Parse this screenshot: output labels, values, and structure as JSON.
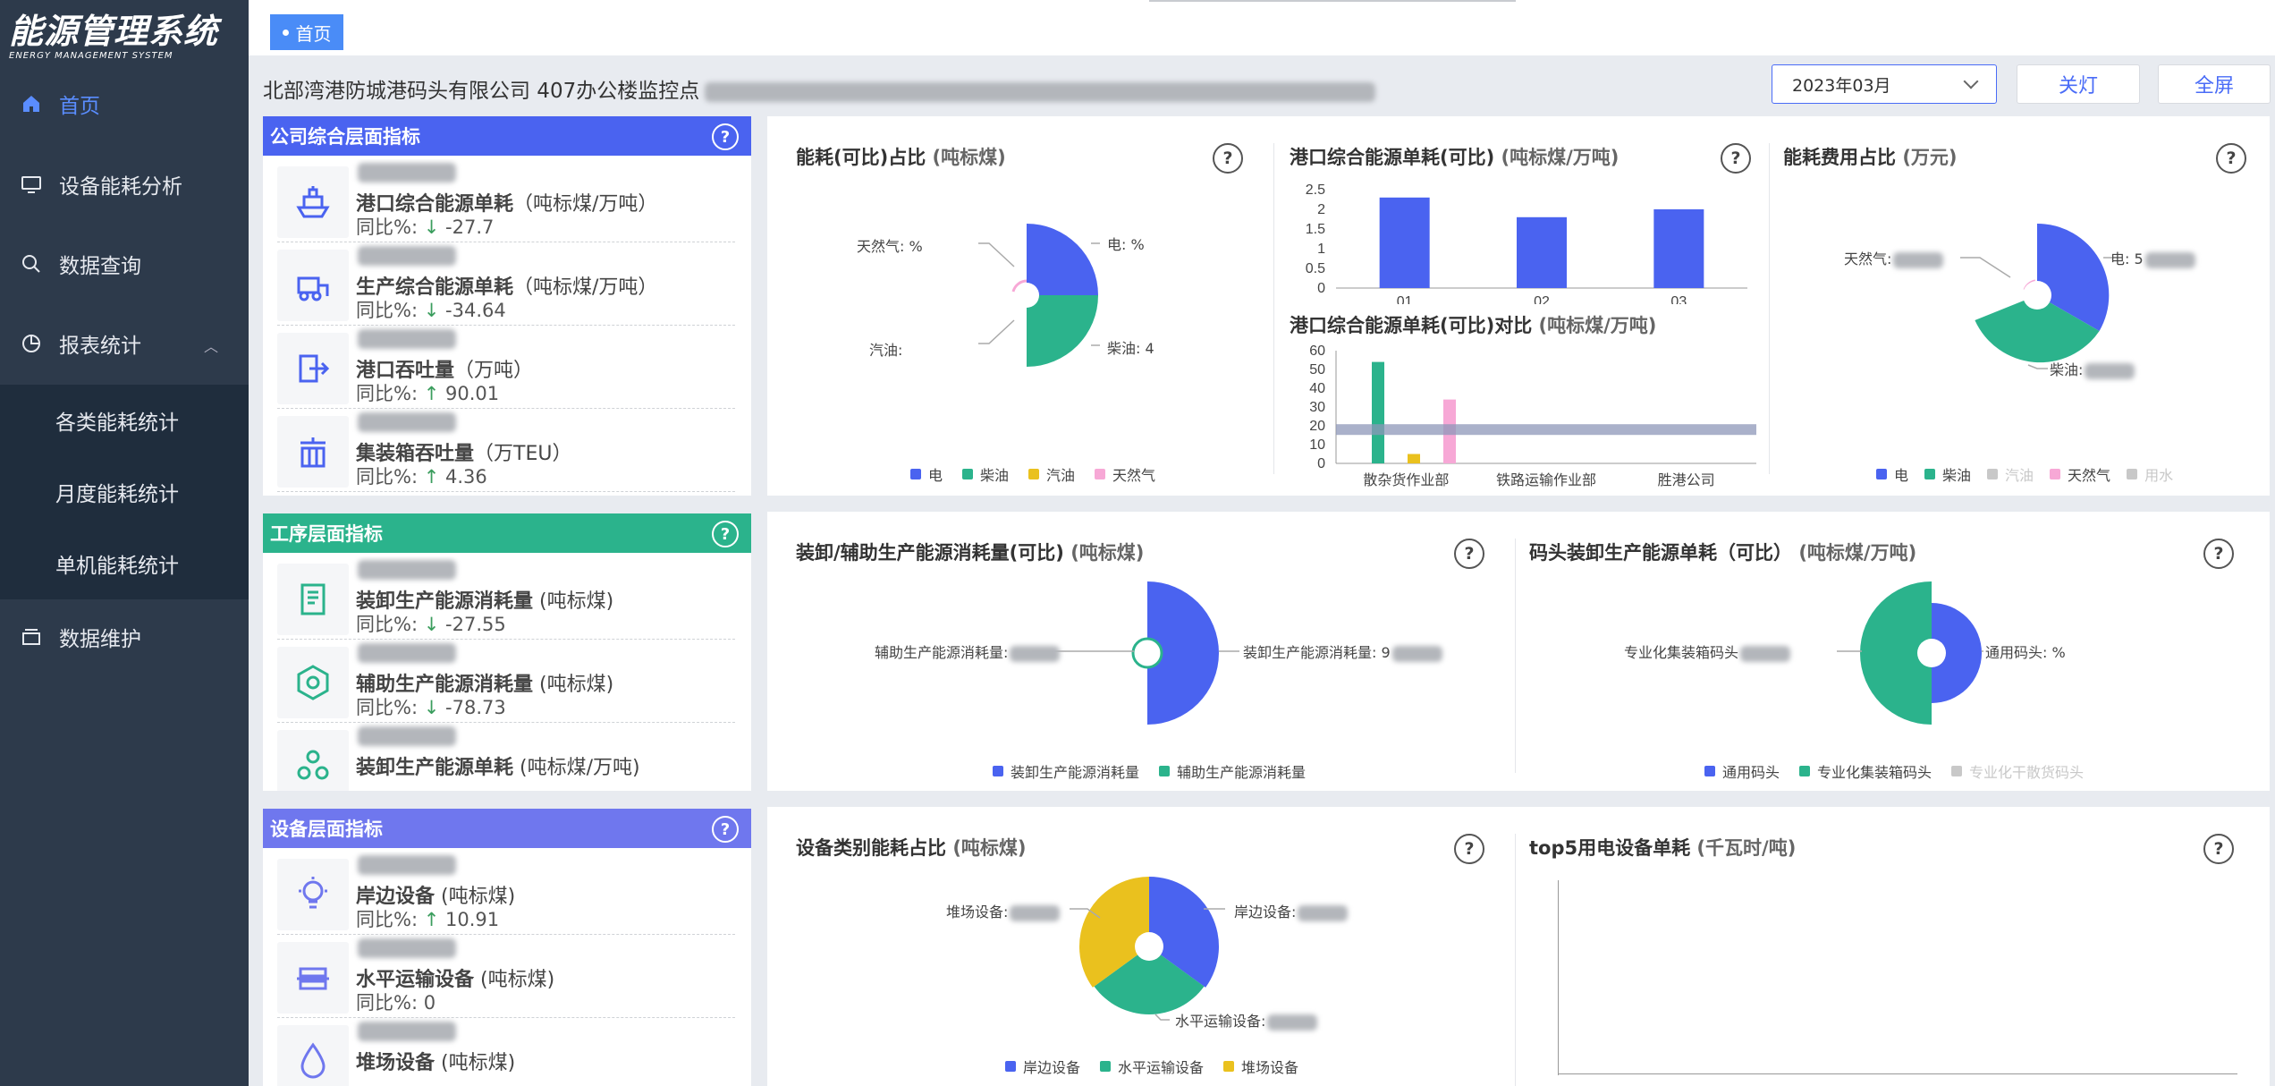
{
  "sidebar": {
    "logo_title": "能源管理系统",
    "logo_subtitle": "ENERGY MANAGEMENT SYSTEM",
    "items": [
      {
        "label": "首页",
        "icon": "home-icon"
      },
      {
        "label": "设备能耗分析",
        "icon": "monitor-icon"
      },
      {
        "label": "数据查询",
        "icon": "search-icon"
      },
      {
        "label": "报表统计",
        "icon": "pie-icon"
      },
      {
        "label": "数据维护",
        "icon": "stack-icon"
      }
    ],
    "subitems": [
      "各类能耗统计",
      "月度能耗统计",
      "单机能耗统计"
    ]
  },
  "tabs": {
    "home": "首页"
  },
  "header": {
    "company": "北部湾港防城港码头有限公司  407办公楼监控点"
  },
  "controls": {
    "date": "2023年03月",
    "lights_off": "关灯",
    "fullscreen": "全屏"
  },
  "company_panel": {
    "title": "公司综合层面指标",
    "help": "?",
    "yoy_label": "同比%:",
    "rows": [
      {
        "name": "港口综合能源单耗",
        "unit": "（吨标煤/万吨）",
        "yoy": "-27.7",
        "dir": "↓",
        "icon": "ship-icon"
      },
      {
        "name": "生产综合能源单耗",
        "unit": "（吨标煤/万吨）",
        "yoy": "-34.64",
        "dir": "↓",
        "icon": "forklift-icon"
      },
      {
        "name": "港口吞吐量",
        "unit": "（万吨）",
        "yoy": "90.01",
        "dir": "↑",
        "icon": "export-icon"
      },
      {
        "name": "集装箱吞吐量",
        "unit": "（万TEU）",
        "yoy": "4.36",
        "dir": "↑",
        "icon": "container-crane-icon"
      }
    ]
  },
  "process_panel": {
    "title": "工序层面指标",
    "help": "?",
    "yoy_label": "同比%:",
    "rows": [
      {
        "name": "装卸生产能源消耗量",
        "unit": " (吨标煤)",
        "yoy": "-27.55",
        "dir": "↓",
        "icon": "document-icon"
      },
      {
        "name": "辅助生产能源消耗量",
        "unit": " (吨标煤)",
        "yoy": "-78.73",
        "dir": "↓",
        "icon": "hexagon-icon"
      },
      {
        "name": "装卸生产能源单耗",
        "unit": " (吨标煤/万吨)",
        "yoy": "",
        "dir": "",
        "icon": "cluster-icon"
      }
    ]
  },
  "equipment_panel": {
    "title": "设备层面指标",
    "help": "?",
    "yoy_label": "同比%:",
    "rows": [
      {
        "name": "岸边设备",
        "unit": " (吨标煤)",
        "yoy": "10.91",
        "dir": "↑",
        "icon": "bulb-icon"
      },
      {
        "name": "水平运输设备",
        "unit": " (吨标煤)",
        "yoy": "0",
        "dir": "",
        "icon": "conveyor-icon"
      },
      {
        "name": "堆场设备",
        "unit": " (吨标煤)",
        "yoy": "",
        "dir": "",
        "icon": "drop-icon"
      }
    ]
  },
  "cards": {
    "energy_share": {
      "title": "能耗(可比)占比",
      "unit": "(吨标煤)"
    },
    "port_unit": {
      "title": "港口综合能源单耗(可比)",
      "unit": "(吨标煤/万吨)"
    },
    "port_unit_compare": {
      "title": "港口综合能源单耗(可比)对比",
      "unit": "(吨标煤/万吨)"
    },
    "cost_share": {
      "title": "能耗费用占比",
      "unit": "(万元)"
    },
    "handling_aux": {
      "title": "装卸/辅助生产能源消耗量(可比)",
      "unit": "(吨标煤)"
    },
    "terminal_unit": {
      "title": "码头装卸生产能源单耗（可比）",
      "unit": "(吨标煤/万吨)"
    },
    "equip_share": {
      "title": "设备类别能耗占比",
      "unit": "(吨标煤)"
    },
    "top5": {
      "title": "top5用电设备单耗",
      "unit": "(千瓦时/吨)"
    }
  },
  "colors": {
    "electric": "#4a63f0",
    "diesel": "#2bb38c",
    "gasoline": "#eac11e",
    "natural_gas": "#f7a8d6",
    "water": "#c9c9c9",
    "company_head": "#4a63f0",
    "process_head": "#2bb38c",
    "equipment_head": "#6f77ee"
  },
  "chart_data": [
    {
      "type": "pie",
      "id": "energy_share",
      "title": "能耗(可比)占比",
      "categories": [
        "电",
        "柴油",
        "汽油",
        "天然气"
      ],
      "values": [
        50,
        50,
        0,
        0
      ],
      "slice_labels": [
        "电: %",
        "柴油: 4",
        "汽油:",
        "天然气: %"
      ],
      "legend": [
        "电",
        "柴油",
        "汽油",
        "天然气"
      ]
    },
    {
      "type": "bar",
      "id": "port_unit",
      "title": "港口综合能源单耗(可比)",
      "categories": [
        "01",
        "02",
        "03"
      ],
      "values": [
        2.3,
        1.8,
        2.0
      ],
      "yticks": [
        "2.5",
        "2",
        "1.5",
        "1",
        "0.5",
        "0"
      ],
      "ylim": [
        0,
        2.5
      ]
    },
    {
      "type": "bar",
      "id": "port_unit_compare",
      "title": "港口综合能源单耗(可比)对比",
      "categories": [
        "散杂货作业部",
        "铁路运输作业部",
        "胜港公司"
      ],
      "series": [
        {
          "name": "柴油",
          "values": [
            54,
            0,
            0
          ]
        },
        {
          "name": "汽油",
          "values": [
            5,
            0,
            0
          ]
        },
        {
          "name": "天然气",
          "values": [
            34,
            0,
            0
          ]
        }
      ],
      "reference_value": 18,
      "yticks": [
        "60",
        "50",
        "40",
        "30",
        "20",
        "10",
        "0"
      ],
      "ylim": [
        0,
        60
      ]
    },
    {
      "type": "pie",
      "id": "cost_share",
      "title": "能耗费用占比",
      "categories": [
        "电",
        "柴油",
        "汽油",
        "天然气",
        "用水"
      ],
      "values": [
        50,
        50,
        0,
        0,
        0
      ],
      "slice_labels": [
        "电: 5",
        "柴油:",
        "天然气:"
      ],
      "legend": [
        "电",
        "柴油",
        "汽油",
        "天然气",
        "用水"
      ]
    },
    {
      "type": "pie",
      "id": "handling_aux",
      "title": "装卸/辅助生产能源消耗量(可比)",
      "categories": [
        "装卸生产能源消耗量",
        "辅助生产能源消耗量"
      ],
      "values": [
        99,
        1
      ],
      "slice_labels": [
        "装卸生产能源消耗量: 9",
        "辅助生产能源消耗量:"
      ],
      "legend": [
        "装卸生产能源消耗量",
        "辅助生产能源消耗量"
      ]
    },
    {
      "type": "pie",
      "id": "terminal_unit",
      "title": "码头装卸生产能源单耗（可比）",
      "categories": [
        "通用码头",
        "专业化集装箱码头",
        "专业化干散货码头"
      ],
      "values": [
        35,
        65,
        0
      ],
      "slice_labels": [
        "通用码头: %",
        "专业化集装箱码头"
      ],
      "legend": [
        "通用码头",
        "专业化集装箱码头",
        "专业化干散货码头"
      ]
    },
    {
      "type": "pie",
      "id": "equip_share",
      "title": "设备类别能耗占比",
      "categories": [
        "岸边设备",
        "水平运输设备",
        "堆场设备"
      ],
      "values": [
        35,
        30,
        35
      ],
      "slice_labels": [
        "岸边设备:",
        "水平运输设备:",
        "堆场设备:"
      ],
      "legend": [
        "岸边设备",
        "水平运输设备",
        "堆场设备"
      ]
    }
  ]
}
